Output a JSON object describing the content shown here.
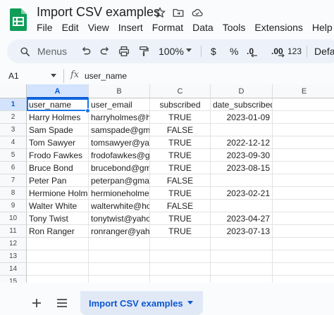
{
  "app": {
    "doc_title": "Import CSV examples",
    "brand_color": "#0f9d58",
    "accent_color": "#0b57d0"
  },
  "menubar": {
    "items": [
      "File",
      "Edit",
      "View",
      "Insert",
      "Format",
      "Data",
      "Tools",
      "Extensions",
      "Help"
    ]
  },
  "toolbar": {
    "search_label": "Menus",
    "zoom": "100%",
    "currency": "$",
    "percent": "%",
    "decrease_decimals": ".0",
    "increase_decimals": ".00",
    "number_format": "123",
    "font": "Defa",
    "icons": [
      "search-icon",
      "undo-icon",
      "redo-icon",
      "print-icon",
      "paint-format-icon",
      "chevron-down-icon"
    ]
  },
  "formula_bar": {
    "cell_ref": "A1",
    "fx": "fx",
    "value": "user_name"
  },
  "grid": {
    "columns": [
      "A",
      "B",
      "C",
      "D",
      "E"
    ],
    "row_numbers": [
      "1",
      "2",
      "3",
      "4",
      "5",
      "6",
      "7",
      "8",
      "9",
      "10",
      "11",
      "12",
      "13",
      "14",
      "15"
    ],
    "rows": [
      [
        "user_name",
        "user_email",
        "subscribed",
        "date_subscribed",
        ""
      ],
      [
        "Harry Holmes",
        "harryholmes@hot",
        "TRUE",
        "2023-01-09",
        ""
      ],
      [
        "Sam Spade",
        "samspade@gmai",
        "FALSE",
        "",
        ""
      ],
      [
        "Tom Sawyer",
        "tomsawyer@yah",
        "TRUE",
        "2022-12-12",
        ""
      ],
      [
        "Frodo Fawkes",
        "frodofawkes@gm",
        "TRUE",
        "2023-09-30",
        ""
      ],
      [
        "Bruce Bond",
        "brucebond@gma",
        "TRUE",
        "2023-08-15",
        ""
      ],
      [
        "Peter Pan",
        "peterpan@gmail",
        "FALSE",
        "",
        ""
      ],
      [
        "Hermione Holme",
        "hermioneholmes",
        "TRUE",
        "2023-02-21",
        ""
      ],
      [
        "Walter White",
        "walterwhite@hot",
        "FALSE",
        "",
        ""
      ],
      [
        "Tony Twist",
        "tonytwist@yaho",
        "TRUE",
        "2023-04-27",
        ""
      ],
      [
        "Ron Ranger",
        "ronranger@yaho",
        "TRUE",
        "2023-07-13",
        ""
      ],
      [
        "",
        "",
        "",
        "",
        ""
      ],
      [
        "",
        "",
        "",
        "",
        ""
      ],
      [
        "",
        "",
        "",
        "",
        ""
      ],
      [
        "",
        "",
        "",
        "",
        ""
      ]
    ],
    "selected_cell": "A1"
  },
  "sheets": {
    "tabs": [
      {
        "label": "Import CSV examples",
        "active": true
      }
    ]
  }
}
